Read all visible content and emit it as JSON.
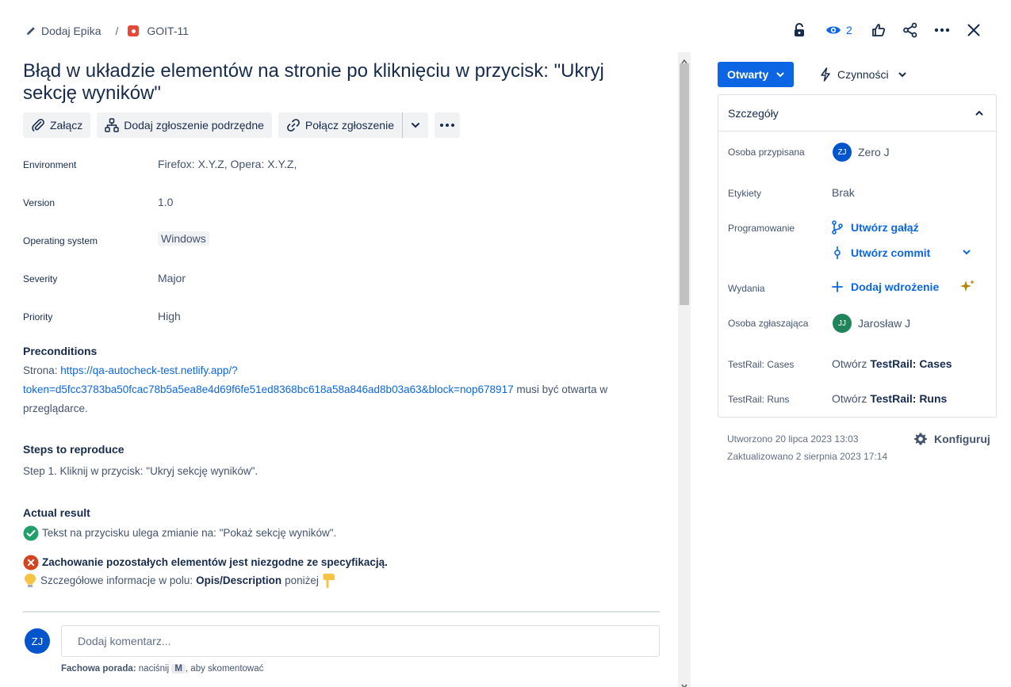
{
  "breadcrumb": {
    "epic_label": "Dodaj Epika",
    "separator": "/",
    "issue_key": "GOIT-11"
  },
  "top_actions": {
    "watchers_count": "2"
  },
  "issue": {
    "title": "Błąd w układzie elementów na stronie po kliknięciu w przycisk: \"Ukryj sekcję wyników\""
  },
  "toolbar": {
    "attach": "Załącz",
    "add_child": "Dodaj zgłoszenie podrzędne",
    "link_issue": "Połącz zgłoszenie"
  },
  "fields": {
    "environment": {
      "label": "Environment",
      "value": "Firefox: X.Y.Z, Opera: X.Y.Z,"
    },
    "version": {
      "label": "Version",
      "value": "1.0"
    },
    "os": {
      "label": "Operating system",
      "value": "Windows"
    },
    "severity": {
      "label": "Severity",
      "value": "Major"
    },
    "priority": {
      "label": "Priority",
      "value": "High"
    }
  },
  "preconditions": {
    "heading": "Preconditions",
    "prefix": "Strona: ",
    "url_line1": "https://qa-autocheck-test.netlify.app/?",
    "url_line2": "token=d5fcc3783ba50fcac78b5a5ea8e4d69f6fe51ed8368bc618a58a846ad8b03a63&block=nop678917",
    "suffix": " musi być otwarta w",
    "line3": "przeglądarce."
  },
  "steps": {
    "heading": "Steps to reproduce",
    "step1": "Step 1. Kliknij w przycisk: \"Ukryj sekcję wyników\"."
  },
  "actual": {
    "heading": "Actual result",
    "ok_text": "Tekst na przycisku ulega zmianie na: \"Pokaż sekcję wyników\".",
    "error_text": "Zachowanie pozostałych elementów jest niezgodne ze specyfikacją.",
    "info_prefix": "Szczegółowe informacje w polu: ",
    "info_bold": "Opis/Description",
    "info_suffix": " poniżej"
  },
  "comment": {
    "avatar_initials": "ZJ",
    "placeholder": "Dodaj komentarz...",
    "tip_bold": "Fachowa porada:",
    "tip_pre": " naciśnij ",
    "tip_key": "M",
    "tip_post": ", aby skomentować"
  },
  "right": {
    "status": "Otwarty",
    "actions": "Czynności",
    "details_title": "Szczegóły",
    "assignee_label": "Osoba przypisana",
    "assignee_initials": "ZJ",
    "assignee_name": "Zero J",
    "labels_label": "Etykiety",
    "labels_value": "Brak",
    "dev_label": "Programowanie",
    "create_branch": "Utwórz gałąź",
    "create_commit": "Utwórz commit",
    "releases_label": "Wydania",
    "add_deployment": "Dodaj wdrożenie",
    "reporter_label": "Osoba zgłaszająca",
    "reporter_initials": "JJ",
    "reporter_name": "Jarosław J",
    "tr_cases_label": "TestRail: Cases",
    "tr_cases_pre": "Otwórz ",
    "tr_cases_bold": "TestRail: Cases",
    "tr_runs_label": "TestRail: Runs",
    "tr_runs_pre": "Otwórz ",
    "tr_runs_bold": "TestRail: Runs",
    "created": "Utworzono 20 lipca 2023 13:03",
    "updated": "Zaktualizowano 2 sierpnia 2023 17:14",
    "configure": "Konfiguruj"
  },
  "colors": {
    "primary": "#0c66e4",
    "bug_red": "#e5493a",
    "success_green": "#22a06b",
    "error_red": "#c9372c",
    "avatar_blue": "#0055cc",
    "avatar_green": "#1f845a"
  },
  "icons": [
    "pencil-icon",
    "bug-icon",
    "lock-icon",
    "eye-icon",
    "thumbs-up-icon",
    "share-icon",
    "more-icon",
    "close-icon",
    "paperclip-icon",
    "hierarchy-icon",
    "link-icon",
    "chevron-down-icon",
    "lightning-icon",
    "chevron-up-icon",
    "branch-icon",
    "commit-icon",
    "plus-icon",
    "sparkle-icon",
    "gear-icon",
    "check-circle-icon",
    "cross-circle-icon",
    "lightbulb-icon",
    "pointing-down-icon"
  ]
}
